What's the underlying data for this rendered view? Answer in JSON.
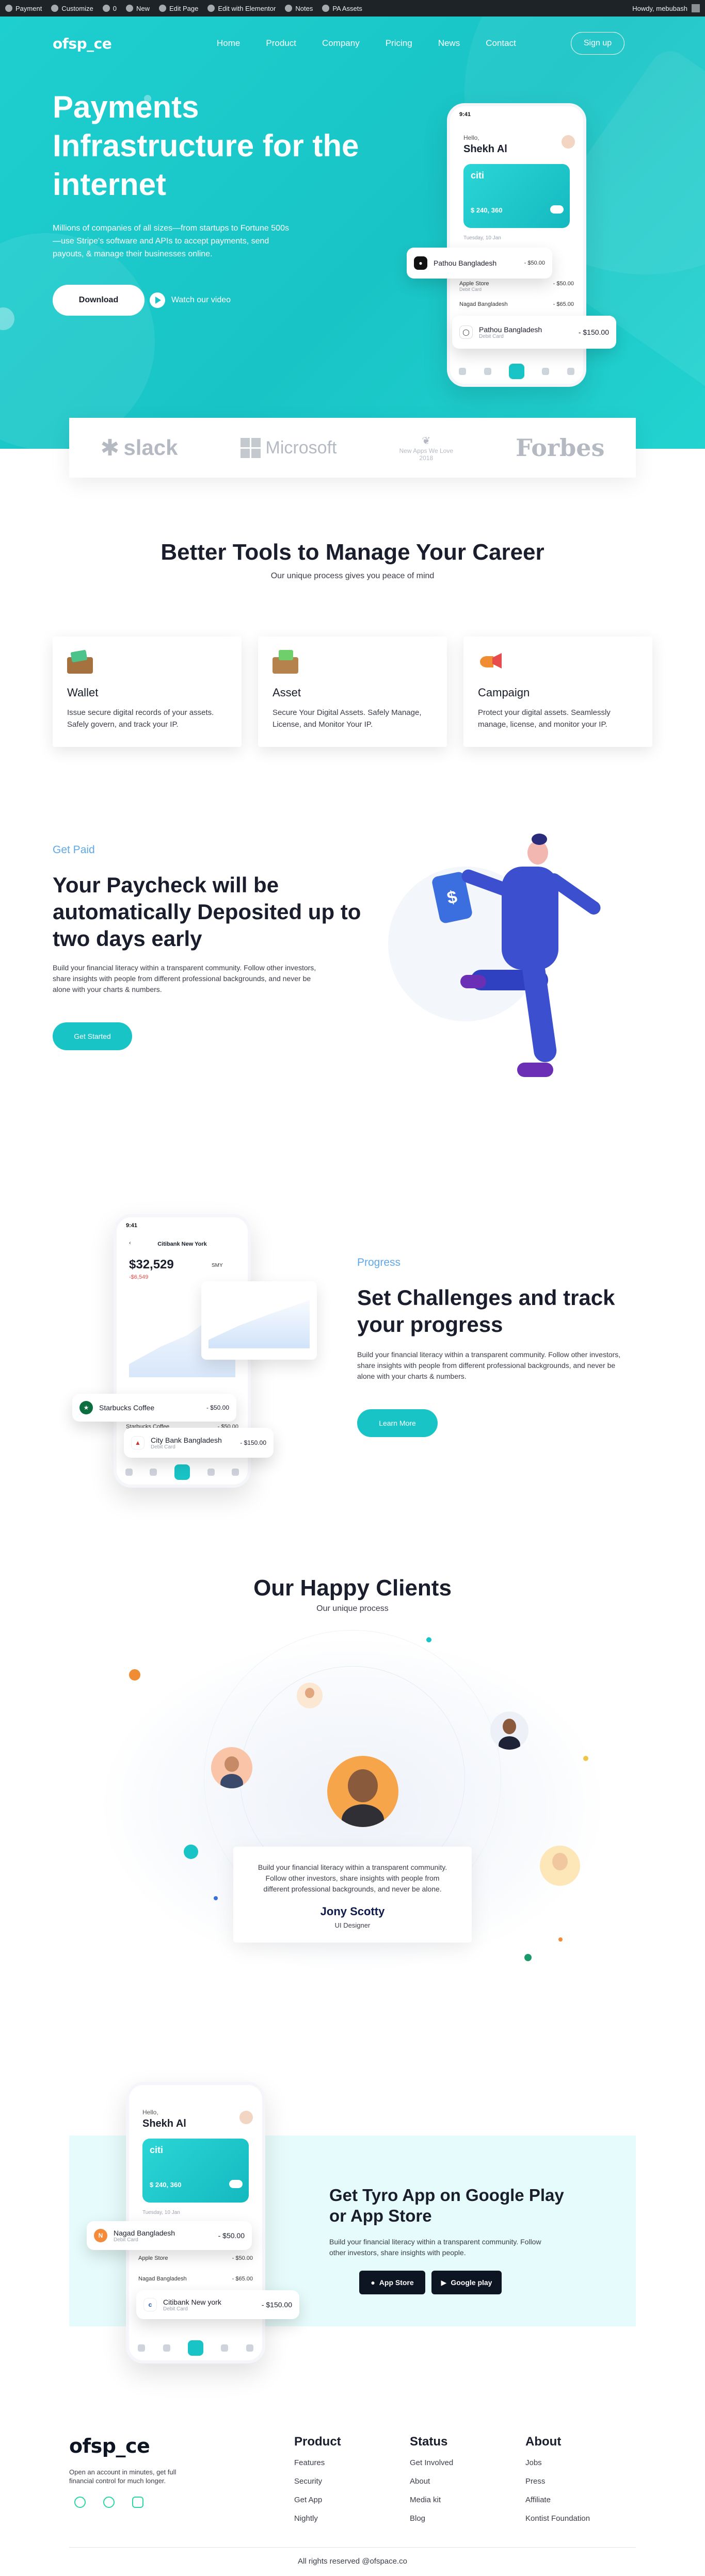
{
  "admin_bar": {
    "items": [
      "Payment",
      "Customize",
      "0",
      "New",
      "Edit Page",
      "Edit with Elementor",
      "Notes",
      "PA Assets"
    ],
    "greeting": "Howdy, mebubash"
  },
  "nav": {
    "logo": "ofsp_ce",
    "links": [
      "Home",
      "Product",
      "Company",
      "Pricing",
      "News",
      "Contact"
    ],
    "signup": "Sign up"
  },
  "hero": {
    "title": "Payments Infrastructure for the internet",
    "description": "Millions of companies of all sizes—from startups to Fortune 500s—use Stripe's software and APIs to accept payments, send payouts, & manage their businesses online.",
    "download": "Download",
    "watch": "Watch our video"
  },
  "hero_phone": {
    "time": "9:41",
    "hello": "Hello,",
    "name": "Shekh Al",
    "card_brand": "citi",
    "card_balance": "$ 240, 360",
    "date": "Tuesday, 10 Jan",
    "rows": [
      {
        "name": "Apple Store",
        "sub": "Debit Card",
        "amount": "- $50.00"
      },
      {
        "name": "Nagad Bangladesh",
        "sub": "",
        "amount": "- $65.00"
      }
    ],
    "float_top": {
      "name": "Pathou Bangladesh",
      "amount": "- $50.00",
      "sub": "Debit Card"
    },
    "float_bottom": {
      "name": "Pathou Bangladesh",
      "amount": "- $150.00",
      "sub": "Debit Card"
    }
  },
  "brands": [
    "slack",
    "Microsoft",
    "New Apps We Love",
    "Forbes"
  ],
  "brand_award_year": "2018",
  "tools_section": {
    "title": "Better Tools to Manage Your Career",
    "subtitle": "Our unique process gives you peace of mind",
    "cards": [
      {
        "title": "Wallet",
        "text": "Issue secure digital records of your assets. Safely govern, and track your IP."
      },
      {
        "title": "Asset",
        "text": "Secure Your Digital Assets. Safely Manage, License, and Monitor Your IP."
      },
      {
        "title": "Campaign",
        "text": "Protect your digital assets. Seamlessly manage, license, and monitor your IP."
      }
    ]
  },
  "get_paid": {
    "kicker": "Get Paid",
    "title": "Your Paycheck will be automatically Deposited up to two days early",
    "text": "Build your financial literacy within a transparent community. Follow other investors, share insights with people from different professional backgrounds, and never be alone with your charts & numbers.",
    "button": "Get Started"
  },
  "progress": {
    "kicker": "Progress",
    "title": "Set Challenges and track your progress",
    "text": "Build your financial literacy within a transparent community. Follow other investors, share insights with people from different professional backgrounds, and never be alone with your charts & numbers.",
    "button": "Learn More",
    "phone": {
      "time": "9:41",
      "header": "Citibank New York",
      "balance": "$32,529",
      "change": "-$6,549",
      "period": "SMY",
      "rows": [
        {
          "name": "Starbucks Coffee",
          "sub": "Debit Card",
          "amount": "- $50.00"
        },
        {
          "name": "City Bank Bangladesh",
          "sub": "Debit Card",
          "amount": "- $150.00"
        }
      ]
    }
  },
  "clients": {
    "title": "Our Happy Clients",
    "subtitle": "Our unique process",
    "quote": "Build your financial literacy within a transparent community. Follow other investors, share insights with people from different professional backgrounds, and never be alone.",
    "name": "Jony Scotty",
    "role": "UI Designer"
  },
  "app": {
    "title": "Get Tyro App on Google Play or App Store",
    "text": "Build your financial literacy within a transparent community. Follow other investors, share insights with people.",
    "app_store": "App Store",
    "google_play": "Google play",
    "phone": {
      "hello": "Hello,",
      "name": "Shekh Al",
      "card_brand": "citi",
      "card_balance": "$ 240, 360",
      "date": "Tuesday, 10 Jan",
      "float_top": {
        "name": "Nagad Bangladesh",
        "amount": "- $50.00",
        "sub": "Debit Card"
      },
      "float_bottom": {
        "name": "Citibank New york",
        "amount": "- $150.00",
        "sub": "Debit Card"
      }
    }
  },
  "footer": {
    "logo": "ofsp_ce",
    "tagline": "Open an account in minutes, get full financial control for much longer.",
    "columns": [
      {
        "title": "Product",
        "links": [
          "Features",
          "Security",
          "Get App",
          "Nightly"
        ]
      },
      {
        "title": "Status",
        "links": [
          "Get Involved",
          "About",
          "Media kit",
          "Blog"
        ]
      },
      {
        "title": "About",
        "links": [
          "Jobs",
          "Press",
          "Affiliate",
          "Kontist Foundation"
        ]
      }
    ],
    "copyright": "All rights reserved @ofspace.co"
  },
  "colors": {
    "primary": "#19c4c6",
    "accent_blue": "#5fa8e8",
    "dark": "#1a1d2b"
  }
}
